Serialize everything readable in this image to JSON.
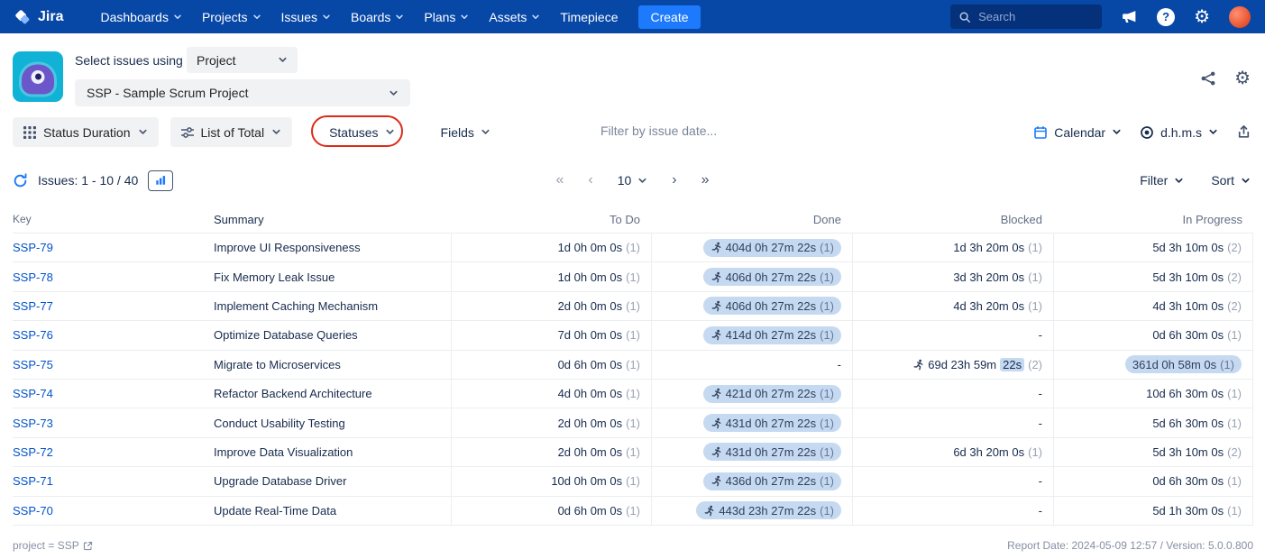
{
  "colors": {
    "nav_bg": "#0747A6",
    "create_bg": "#1D7AFC",
    "link": "#0052CC",
    "pill_bg": "#C5DAF1",
    "annotation_red": "#DB2B17",
    "app_tile_teal": "#10B3D6"
  },
  "icons": {
    "gear": "⚙",
    "question": "?",
    "search": "magnifier-svg",
    "megaphone": "megaphone-svg",
    "share": "share-nodes-svg",
    "calendar": "calendar-svg",
    "time_format": "circle-dot-svg",
    "export": "box-up-arrow-svg",
    "refresh": "circular-arrow-svg",
    "chart": "bar-chart-svg",
    "runner": "running-person-svg",
    "external_link": "external-link-svg"
  },
  "nav": {
    "brand": "Jira",
    "items": [
      {
        "label": "Dashboards"
      },
      {
        "label": "Projects"
      },
      {
        "label": "Issues"
      },
      {
        "label": "Boards"
      },
      {
        "label": "Plans"
      },
      {
        "label": "Assets"
      },
      {
        "label": "Timepiece"
      }
    ],
    "create_label": "Create",
    "search_placeholder": "Search"
  },
  "header": {
    "select_label": "Select issues using",
    "mode_value": "Project",
    "project_value": "SSP - Sample Scrum Project"
  },
  "toolbar": {
    "status_duration": "Status Duration",
    "list_of_total": "List of Total",
    "statuses": "Statuses",
    "fields": "Fields",
    "date_filter_placeholder": "Filter by issue date...",
    "calendar": "Calendar",
    "time_format": "d.h.m.s"
  },
  "pager": {
    "issues_label": "Issues: 1 - 10 / 40",
    "first": "«",
    "prev": "‹",
    "page_size": "10",
    "next": "›",
    "last": "»",
    "filter": "Filter",
    "sort": "Sort"
  },
  "table": {
    "columns": [
      "Key",
      "Summary",
      "To Do",
      "Done",
      "Blocked",
      "In Progress"
    ],
    "rows": [
      {
        "key": "SSP-79",
        "summary": "Improve UI Responsiveness",
        "todo": {
          "text": "1d 0h 0m 0s",
          "count": "(1)"
        },
        "done": {
          "pill": true,
          "icon": true,
          "text": "404d 0h 27m 22s",
          "count": "(1)"
        },
        "blocked": {
          "text": "1d 3h 20m 0s",
          "count": "(1)"
        },
        "inprogress": {
          "text": "5d 3h 10m 0s",
          "count": "(2)"
        }
      },
      {
        "key": "SSP-78",
        "summary": "Fix Memory Leak Issue",
        "todo": {
          "text": "1d 0h 0m 0s",
          "count": "(1)"
        },
        "done": {
          "pill": true,
          "icon": true,
          "text": "406d 0h 27m 22s",
          "count": "(1)"
        },
        "blocked": {
          "text": "3d 3h 20m 0s",
          "count": "(1)"
        },
        "inprogress": {
          "text": "5d 3h 10m 0s",
          "count": "(2)"
        }
      },
      {
        "key": "SSP-77",
        "summary": "Implement Caching Mechanism",
        "todo": {
          "text": "2d 0h 0m 0s",
          "count": "(1)"
        },
        "done": {
          "pill": true,
          "icon": true,
          "text": "406d 0h 27m 22s",
          "count": "(1)"
        },
        "blocked": {
          "text": "4d 3h 20m 0s",
          "count": "(1)"
        },
        "inprogress": {
          "text": "4d 3h 10m 0s",
          "count": "(2)"
        }
      },
      {
        "key": "SSP-76",
        "summary": "Optimize Database Queries",
        "todo": {
          "text": "7d 0h 0m 0s",
          "count": "(1)"
        },
        "done": {
          "pill": true,
          "icon": true,
          "text": "414d 0h 27m 22s",
          "count": "(1)"
        },
        "blocked": {
          "text": "-"
        },
        "inprogress": {
          "text": "0d 6h 30m 0s",
          "count": "(1)"
        }
      },
      {
        "key": "SSP-75",
        "summary": "Migrate to Microservices",
        "todo": {
          "text": "0d 6h 0m 0s",
          "count": "(1)"
        },
        "done": {
          "text": "-"
        },
        "blocked": {
          "icon": true,
          "text": "69d 23h 59m",
          "highlight": "22s",
          "count": "(2)"
        },
        "inprogress": {
          "pill": true,
          "text": "361d 0h 58m 0s",
          "count": "(1)"
        }
      },
      {
        "key": "SSP-74",
        "summary": "Refactor Backend Architecture",
        "todo": {
          "text": "4d 0h 0m 0s",
          "count": "(1)"
        },
        "done": {
          "pill": true,
          "icon": true,
          "text": "421d 0h 27m 22s",
          "count": "(1)"
        },
        "blocked": {
          "text": "-"
        },
        "inprogress": {
          "text": "10d 6h 30m 0s",
          "count": "(1)"
        }
      },
      {
        "key": "SSP-73",
        "summary": "Conduct Usability Testing",
        "todo": {
          "text": "2d 0h 0m 0s",
          "count": "(1)"
        },
        "done": {
          "pill": true,
          "icon": true,
          "text": "431d 0h 27m 22s",
          "count": "(1)"
        },
        "blocked": {
          "text": "-"
        },
        "inprogress": {
          "text": "5d 6h 30m 0s",
          "count": "(1)"
        }
      },
      {
        "key": "SSP-72",
        "summary": "Improve Data Visualization",
        "todo": {
          "text": "2d 0h 0m 0s",
          "count": "(1)"
        },
        "done": {
          "pill": true,
          "icon": true,
          "text": "431d 0h 27m 22s",
          "count": "(1)"
        },
        "blocked": {
          "text": "6d 3h 20m 0s",
          "count": "(1)"
        },
        "inprogress": {
          "text": "5d 3h 10m 0s",
          "count": "(2)"
        }
      },
      {
        "key": "SSP-71",
        "summary": "Upgrade Database Driver",
        "todo": {
          "text": "10d 0h 0m 0s",
          "count": "(1)"
        },
        "done": {
          "pill": true,
          "icon": true,
          "text": "436d 0h 27m 22s",
          "count": "(1)"
        },
        "blocked": {
          "text": "-"
        },
        "inprogress": {
          "text": "0d 6h 30m 0s",
          "count": "(1)"
        }
      },
      {
        "key": "SSP-70",
        "summary": "Update Real-Time Data",
        "todo": {
          "text": "0d 6h 0m 0s",
          "count": "(1)"
        },
        "done": {
          "pill": true,
          "icon": true,
          "text": "443d 23h 27m 22s",
          "count": "(1)"
        },
        "blocked": {
          "text": "-"
        },
        "inprogress": {
          "text": "5d 1h 30m 0s",
          "count": "(1)"
        }
      }
    ]
  },
  "footer": {
    "jql": "project = SSP",
    "report_info": "Report Date: 2024-05-09 12:57 / Version: 5.0.0.800"
  }
}
